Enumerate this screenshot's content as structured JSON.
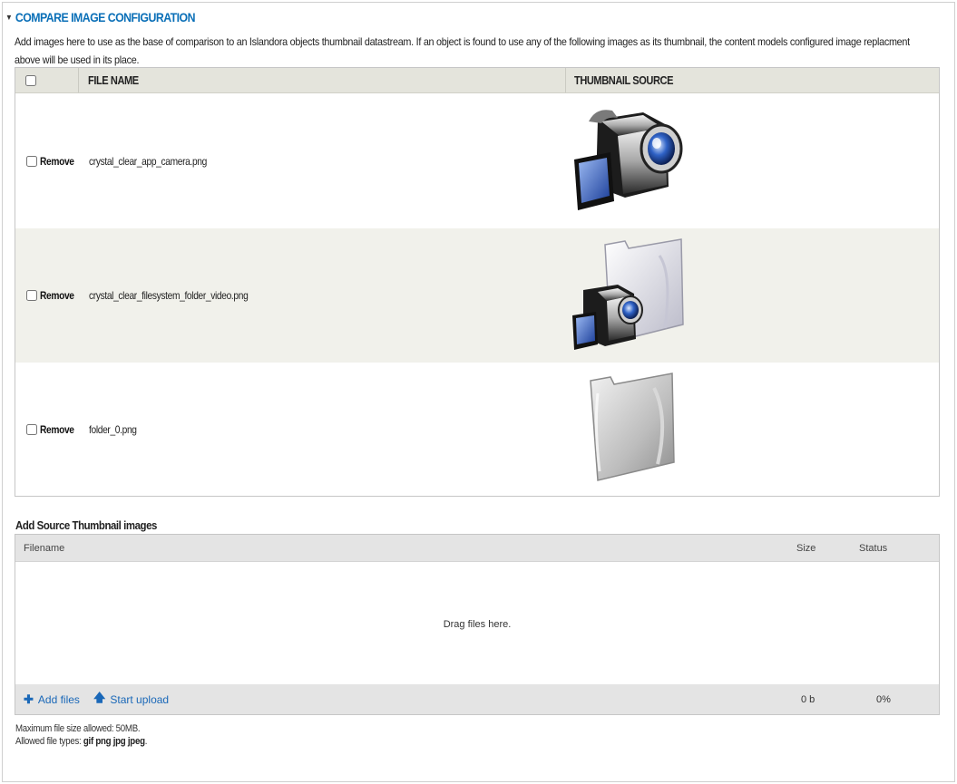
{
  "section": {
    "title": "COMPARE IMAGE CONFIGURATION",
    "description": "Add images here to use as the base of comparison to an Islandora objects thumbnail datastream. If an object is found to use any of the following images as its thumbnail, the content models configured image replacment above will be used in its place."
  },
  "compare_table": {
    "headers": {
      "file_name": "FILE NAME",
      "thumbnail_source": "THUMBNAIL SOURCE"
    },
    "rows": [
      {
        "remove_label": "Remove",
        "file_name": "crystal_clear_app_camera.png",
        "thumbnail_icon": "camcorder-icon"
      },
      {
        "remove_label": "Remove",
        "file_name": "crystal_clear_filesystem_folder_video.png",
        "thumbnail_icon": "video-folder-icon"
      },
      {
        "remove_label": "Remove",
        "file_name": "folder_0.png",
        "thumbnail_icon": "folder-icon"
      }
    ]
  },
  "uploader": {
    "title": "Add Source Thumbnail images",
    "headers": {
      "filename": "Filename",
      "size": "Size",
      "status": "Status"
    },
    "drop_text": "Drag files here.",
    "add_files_label": "Add files",
    "start_upload_label": "Start upload",
    "total_size": "0 b",
    "total_percent": "0%"
  },
  "help": {
    "max_size": "Maximum file size allowed: 50MB.",
    "allowed_types_prefix": "Allowed file types:",
    "allowed_types": "gif png jpg jpeg",
    "allowed_types_suffix": "."
  },
  "colors": {
    "legend": "#0a6fb7",
    "link": "#1a68b8",
    "header_bg": "#e4e4dc",
    "alt_row": "#f1f1eb"
  }
}
